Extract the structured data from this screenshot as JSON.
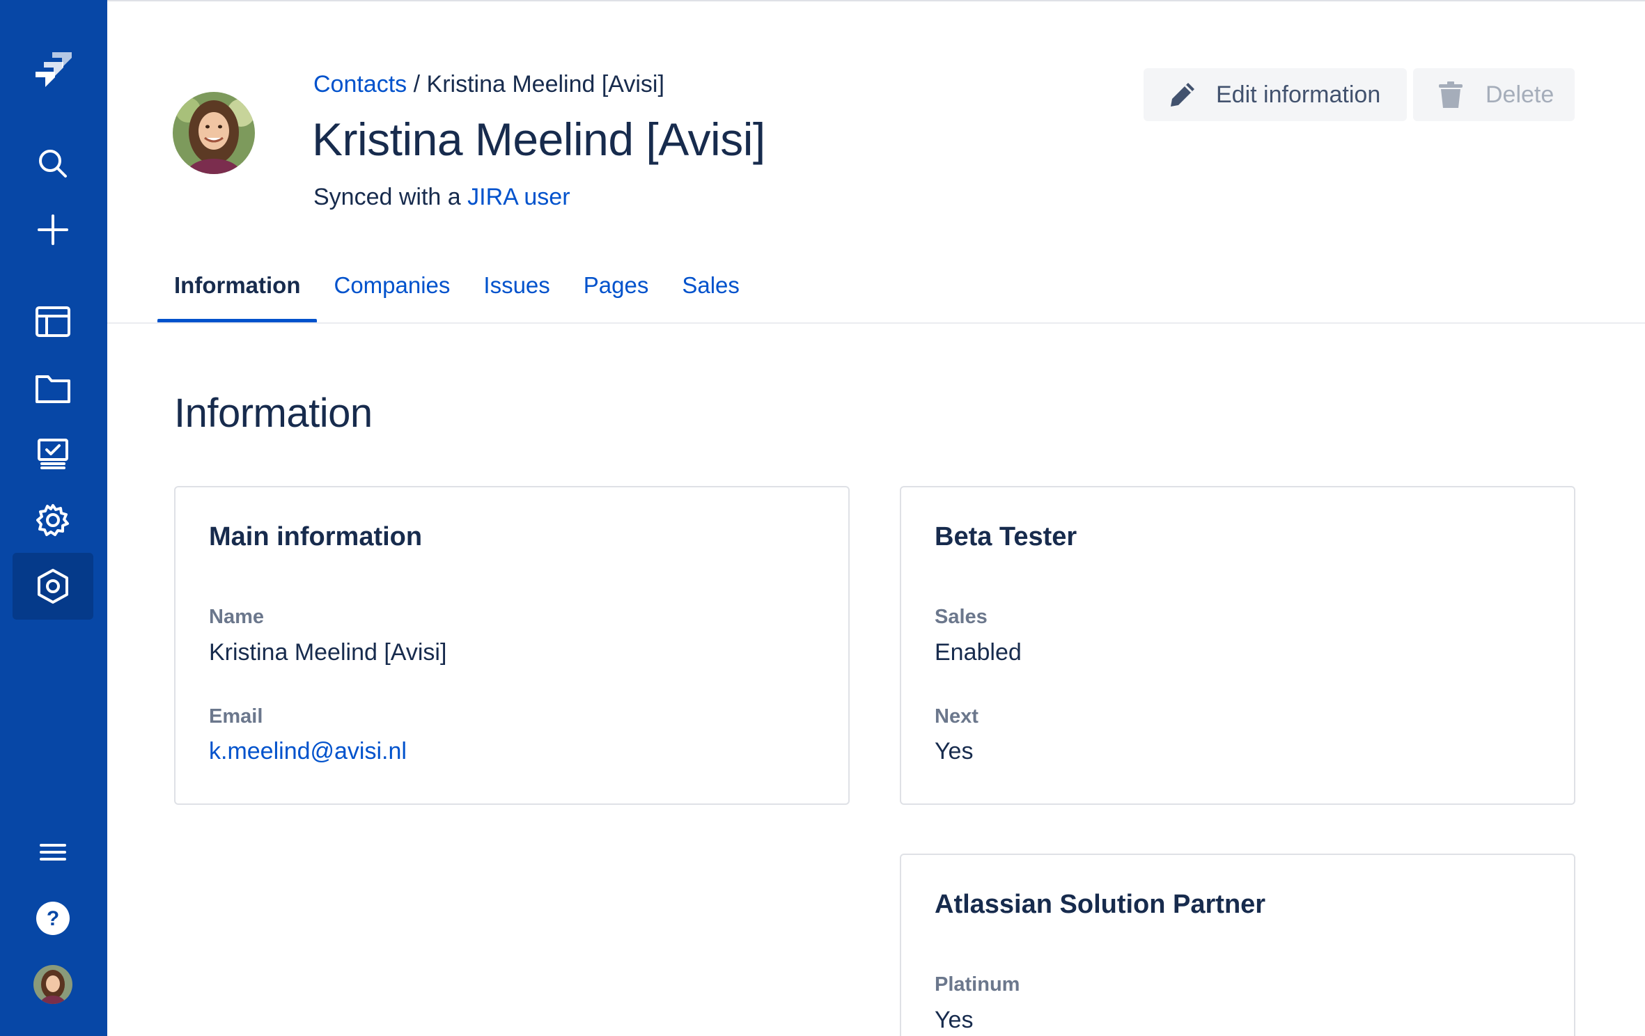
{
  "sidebar": {
    "logo_icon": "jira-logo-icon",
    "items": [
      {
        "icon": "search-icon"
      },
      {
        "icon": "plus-icon"
      },
      {
        "icon": "board-icon"
      },
      {
        "icon": "folder-icon"
      },
      {
        "icon": "monitor-check-icon"
      },
      {
        "icon": "gear-icon"
      },
      {
        "icon": "hexagon-icon",
        "active": true
      }
    ],
    "bottom": [
      {
        "icon": "menu-icon"
      },
      {
        "icon": "help-icon"
      },
      {
        "icon": "user-avatar"
      }
    ],
    "color": "#0747a6"
  },
  "header": {
    "breadcrumb_link": "Contacts",
    "breadcrumb_sep": " / ",
    "breadcrumb_current": "Kristina Meelind [Avisi]",
    "title": "Kristina Meelind [Avisi]",
    "sync_prefix": "Synced with a ",
    "sync_link": "JIRA user",
    "edit_label": "Edit information",
    "delete_label": "Delete"
  },
  "tabs": [
    {
      "label": "Information",
      "active": true
    },
    {
      "label": "Companies"
    },
    {
      "label": "Issues"
    },
    {
      "label": "Pages"
    },
    {
      "label": "Sales"
    }
  ],
  "section_title": "Information",
  "cards": {
    "main": {
      "title": "Main information",
      "fields": [
        {
          "label": "Name",
          "value": "Kristina Meelind [Avisi]"
        },
        {
          "label": "Email",
          "value": "k.meelind@avisi.nl"
        }
      ]
    },
    "beta": {
      "title": "Beta Tester",
      "fields": [
        {
          "label": "Sales",
          "value": "Enabled"
        },
        {
          "label": "Next",
          "value": "Yes"
        }
      ]
    },
    "partner": {
      "title": "Atlassian Solution Partner",
      "fields": [
        {
          "label": "Platinum",
          "value": "Yes"
        }
      ]
    }
  },
  "colors": {
    "accent": "#0052cc",
    "text": "#172b4d",
    "muted": "#6b778c"
  }
}
